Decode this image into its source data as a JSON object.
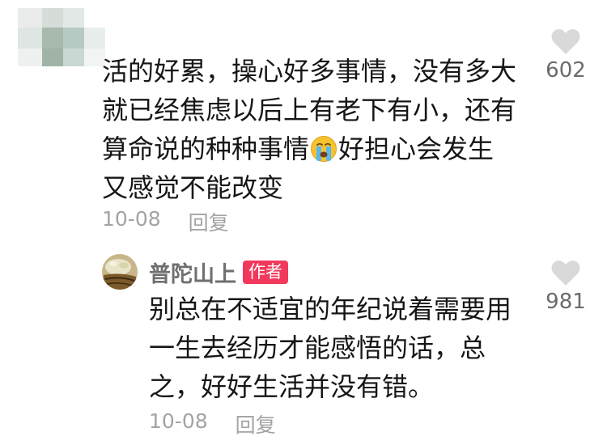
{
  "comments": [
    {
      "text_line1": "活的好累，操心好多事情，没有多大",
      "text_line2": "就已经焦虑以后上有老下有小，还有",
      "text_line3a": "算命说的种种事情",
      "emoji_icon": "loudly-crying-face-icon",
      "text_line3b": "好担心会发生",
      "text_line4": "又感觉不能改变",
      "date": "10-08",
      "reply_label": "回复",
      "like_icon": "heart-outline-icon",
      "like_count": "602"
    },
    {
      "author": {
        "name": "普陀山上",
        "badge": "作者"
      },
      "text_line1": "别总在不适宜的年纪说着需要用",
      "text_line2": "一生去经历才能感悟的话，总",
      "text_line3": "之，好好生活并没有错。",
      "date": "10-08",
      "reply_label": "回复",
      "like_icon": "heart-outline-icon",
      "like_count": "981"
    }
  ],
  "colors": {
    "text": "#161616",
    "meta": "#a3a3a3",
    "like_icon": "#d9d9d9",
    "badge_bg": "#f0395c",
    "author_name": "#6f6f6f"
  }
}
